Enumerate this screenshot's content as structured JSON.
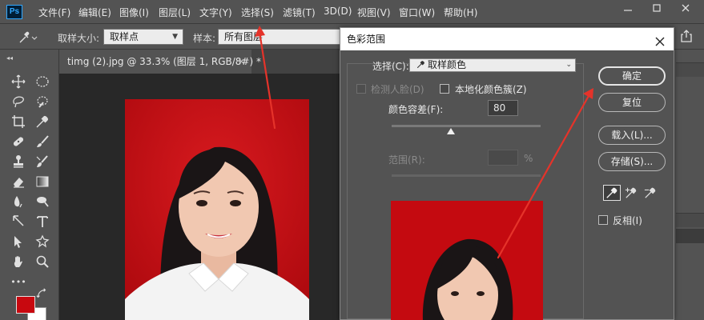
{
  "app": {
    "logo": "Ps",
    "menu": [
      "文件(F)",
      "编辑(E)",
      "图像(I)",
      "图层(L)",
      "文字(Y)",
      "选择(S)",
      "滤镜(T)",
      "3D(D)",
      "视图(V)",
      "窗口(W)",
      "帮助(H)"
    ]
  },
  "options_bar": {
    "sample_size_label": "取样大小:",
    "sample_size_value": "取样点",
    "sample_label": "样本:",
    "sample_value": "所有图层"
  },
  "document": {
    "tab_title": "timg (2).jpg @ 33.3% (图层 1, RGB/8#) *",
    "tab_close": "×"
  },
  "toolbar": {
    "foreground_color": "#c8080f",
    "background_color": "#ffffff",
    "more": "•••"
  },
  "dialog": {
    "title": "色彩范围",
    "select_label": "选择(C):",
    "select_value": "取样颜色",
    "detect_faces_label": "检测人脸(D)",
    "localized_clusters_label": "本地化颜色簇(Z)",
    "fuzziness_label": "颜色容差(F):",
    "fuzziness_value": "80",
    "range_label": "范围(R):",
    "range_unit": "%",
    "ok_label": "确定",
    "reset_label": "复位",
    "load_label": "载入(L)...",
    "save_label": "存储(S)...",
    "invert_label": "反相(I)",
    "fuzziness_slider_fraction": 0.4,
    "detect_faces_checked": false,
    "localized_clusters_checked": false,
    "invert_checked": false
  },
  "colors": {
    "accent_arrow": "#e5332a",
    "photo_background": "#c40a10",
    "panel": "#535353",
    "canvas": "#282828"
  }
}
